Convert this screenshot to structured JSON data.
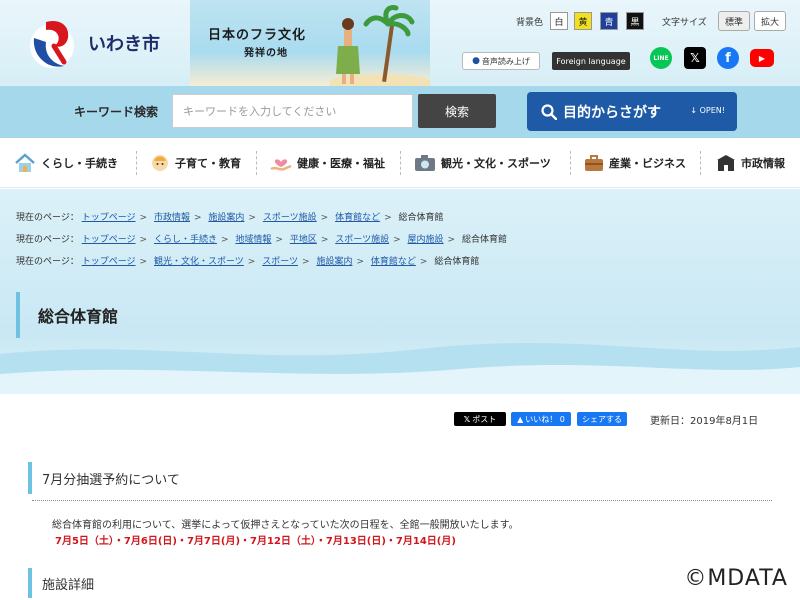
{
  "header": {
    "logo_text": "いわき市",
    "banner_title": "日本のフラ文化",
    "banner_sub": "発祥の地",
    "bg_color_label": "背景色",
    "bg_colors": [
      {
        "label": "白",
        "bg": "#ffffff",
        "fg": "#222222"
      },
      {
        "label": "黄",
        "bg": "#f2e020",
        "fg": "#222222"
      },
      {
        "label": "青",
        "bg": "#1f3f9a",
        "fg": "#ffffff"
      },
      {
        "label": "黒",
        "bg": "#111111",
        "fg": "#ffffff"
      }
    ],
    "font_size_label": "文字サイズ",
    "font_size_standard": "標準",
    "font_size_large": "拡大",
    "voice_label": "音声読み上げ",
    "foreign_label": "Foreign language"
  },
  "search": {
    "label": "キーワード検索",
    "placeholder": "キーワードを入力してください",
    "button": "検索",
    "purpose_label": "目的からさがす",
    "purpose_open": "OPEN!"
  },
  "nav": [
    {
      "label": "くらし・手続き",
      "icon": "house-icon"
    },
    {
      "label": "子育て・教育",
      "icon": "child-icon"
    },
    {
      "label": "健康・医療・福祉",
      "icon": "heart-hand-icon"
    },
    {
      "label": "観光・文化・スポーツ",
      "icon": "camera-icon"
    },
    {
      "label": "産業・ビジネス",
      "icon": "briefcase-icon"
    },
    {
      "label": "市政情報",
      "icon": "city-hall-icon"
    }
  ],
  "breadcrumbs": [
    {
      "prefix": "現在のページ：",
      "links": [
        "トップページ",
        "市政情報",
        "施設案内",
        "スポーツ施設",
        "体育館など"
      ],
      "current": "総合体育館"
    },
    {
      "prefix": "現在のページ：",
      "links": [
        "トップページ",
        "くらし・手続き",
        "地域情報",
        "平地区",
        "スポーツ施設",
        "屋内施設"
      ],
      "current": "総合体育館"
    },
    {
      "prefix": "現在のページ：",
      "links": [
        "トップページ",
        "観光・文化・スポーツ",
        "スポーツ",
        "施設案内",
        "体育館など"
      ],
      "current": "総合体育館"
    }
  ],
  "page": {
    "title": "総合体育館",
    "share_x": "ポスト",
    "share_fb_like": "いいね！ 0",
    "share_fb_share": "シェアする",
    "updated": "更新日：2019年8月1日"
  },
  "sections": {
    "lottery_heading": "7月分抽選予約について",
    "lottery_body": "総合体育館の利用について、選挙によって仮押さえとなっていた次の日程を、全館一般開放いたします。",
    "lottery_dates": "7月5日（土）・7月6日(日)・7月7日(月)・7月12日（土）・7月13日(日)・7月14日(月)",
    "facility_heading": "施設詳細"
  },
  "watermark": "©MDATA"
}
